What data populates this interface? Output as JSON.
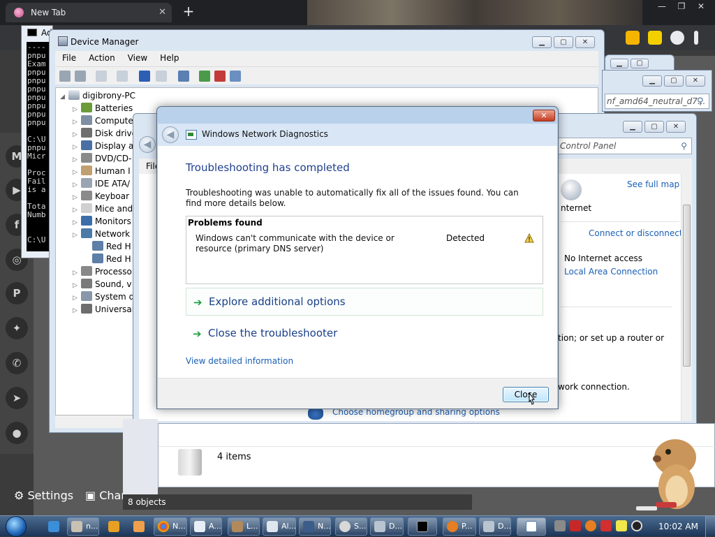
{
  "browser": {
    "tab_title": "New Tab",
    "tab_close": "✕",
    "new_tab": "+",
    "window_controls": [
      "—",
      "❐",
      "✕"
    ],
    "settings_label": "Settings",
    "channel_label": "Chan"
  },
  "console": {
    "title": "Ad",
    "lines": [
      "----",
      "pnpu",
      "Exam",
      "pnpu",
      "pnpu",
      "pnpu",
      "pnpu",
      "pnpu",
      "pnpu",
      "pnpu",
      "",
      "C:\\U",
      "pnpu",
      "Micr",
      "",
      "Proc",
      "Fail",
      "is a",
      "",
      "Tota",
      "Numb",
      "",
      "",
      "C:\\U"
    ]
  },
  "device_manager": {
    "title": "Device Manager",
    "menu": [
      "File",
      "Action",
      "View",
      "Help"
    ],
    "computer": "digibrony-PC",
    "categories": [
      "Batteries",
      "Compute",
      "Disk drive",
      "Display a",
      "DVD/CD-",
      "Human I",
      "IDE ATA/",
      "Keyboar",
      "Mice and",
      "Monitors",
      "Network",
      "Red H",
      "Red H",
      "Processo",
      "Sound, v",
      "System d",
      "Universal"
    ]
  },
  "control_panel": {
    "search_back": "nf_amd64_neutral_d7...",
    "search": "Control Panel",
    "menu_file": "File",
    "see_full_map": "See full map",
    "internet_label": "nternet",
    "connect_disconnect": "Connect or disconnect",
    "no_internet": "No Internet access",
    "local_area": "Local Area Connection",
    "setup_text": "tion; or set up a router or",
    "network_conn_text": "work connection.",
    "homegroup_link": "Choose homegroup and sharing options"
  },
  "explorer": {
    "items_count": "4 items",
    "status_objects": "8 objects"
  },
  "dialog": {
    "title": "Windows Network Diagnostics",
    "close_glyph": "✕",
    "heading": "Troubleshooting has completed",
    "description": "Troubleshooting was unable to automatically fix all of the issues found. You can find more details below.",
    "problems_header": "Problems found",
    "problem_text": "Windows can't communicate with the device or resource (primary DNS server)",
    "problem_status": "Detected",
    "option_explore": "Explore additional options",
    "option_close": "Close the troubleshooter",
    "detail_link": "View detailed information",
    "close_button": "Close"
  },
  "taskbar": {
    "buttons": [
      "n...",
      "L...",
      "Al...",
      "N...",
      "S...",
      "D...",
      "P...",
      "D..."
    ],
    "chrome_button": "N...",
    "a_button": "A...",
    "clock": "10:02 AM"
  },
  "colors": {
    "accent_heading": "#1e3f8e",
    "link": "#1a5fb4",
    "taskbar": "#1c3557",
    "close_red": "#c33d22"
  }
}
